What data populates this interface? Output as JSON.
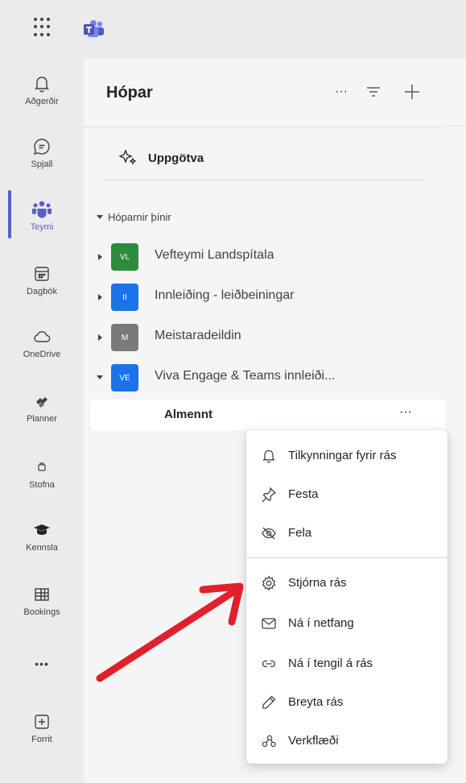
{
  "rail": {
    "items": [
      {
        "label": "Aðgerðir",
        "icon": "bell-icon"
      },
      {
        "label": "Spjall",
        "icon": "chat-icon"
      },
      {
        "label": "Teymi",
        "icon": "teams-icon",
        "active": true
      },
      {
        "label": "Dagbók",
        "icon": "calendar-icon"
      },
      {
        "label": "OneDrive",
        "icon": "cloud-icon"
      },
      {
        "label": "Planner",
        "icon": "planner-icon"
      },
      {
        "label": "Stofna",
        "icon": "create-icon"
      },
      {
        "label": "Kennsla",
        "icon": "graduation-cap-icon"
      },
      {
        "label": "Bookings",
        "icon": "bookings-icon"
      },
      {
        "label": "...",
        "icon": "more-icon"
      },
      {
        "label": "Forrit",
        "icon": "apps-add-icon"
      }
    ],
    "more_label": "•••",
    "accent": "#5b5fc7"
  },
  "panel": {
    "title": "Hópar",
    "more_label": "···",
    "discover_label": "Uppgötva",
    "section_label": "Hóparnir þínir"
  },
  "teams": [
    {
      "initials": "VL",
      "name": "Vefteymi Landspítala",
      "color": "#2e8b3e"
    },
    {
      "initials": "II",
      "name": "Innleiðing - leiðbeiningar",
      "color": "#1a73e8"
    },
    {
      "initials": "M",
      "name": "Meistaradeildin",
      "color": "#7a7a7a"
    },
    {
      "initials": "VE",
      "name": "Viva Engage & Teams innleiði...",
      "color": "#1a73e8"
    }
  ],
  "channel": {
    "name": "Almennt",
    "more_label": "···"
  },
  "context_menu": {
    "items": [
      {
        "label": "Tilkynningar fyrir rás",
        "icon": "bell-icon"
      },
      {
        "label": "Festa",
        "icon": "pin-icon"
      },
      {
        "label": "Fela",
        "icon": "eye-off-icon"
      },
      {
        "label": "Stjórna rás",
        "icon": "gear-icon"
      },
      {
        "label": "Ná í netfang",
        "icon": "mail-icon"
      },
      {
        "label": "Ná í tengil á rás",
        "icon": "link-icon"
      },
      {
        "label": "Breyta rás",
        "icon": "pencil-icon"
      },
      {
        "label": "Verkflæði",
        "icon": "workflow-icon"
      }
    ]
  },
  "annotation": {
    "color": "#e0202c"
  }
}
